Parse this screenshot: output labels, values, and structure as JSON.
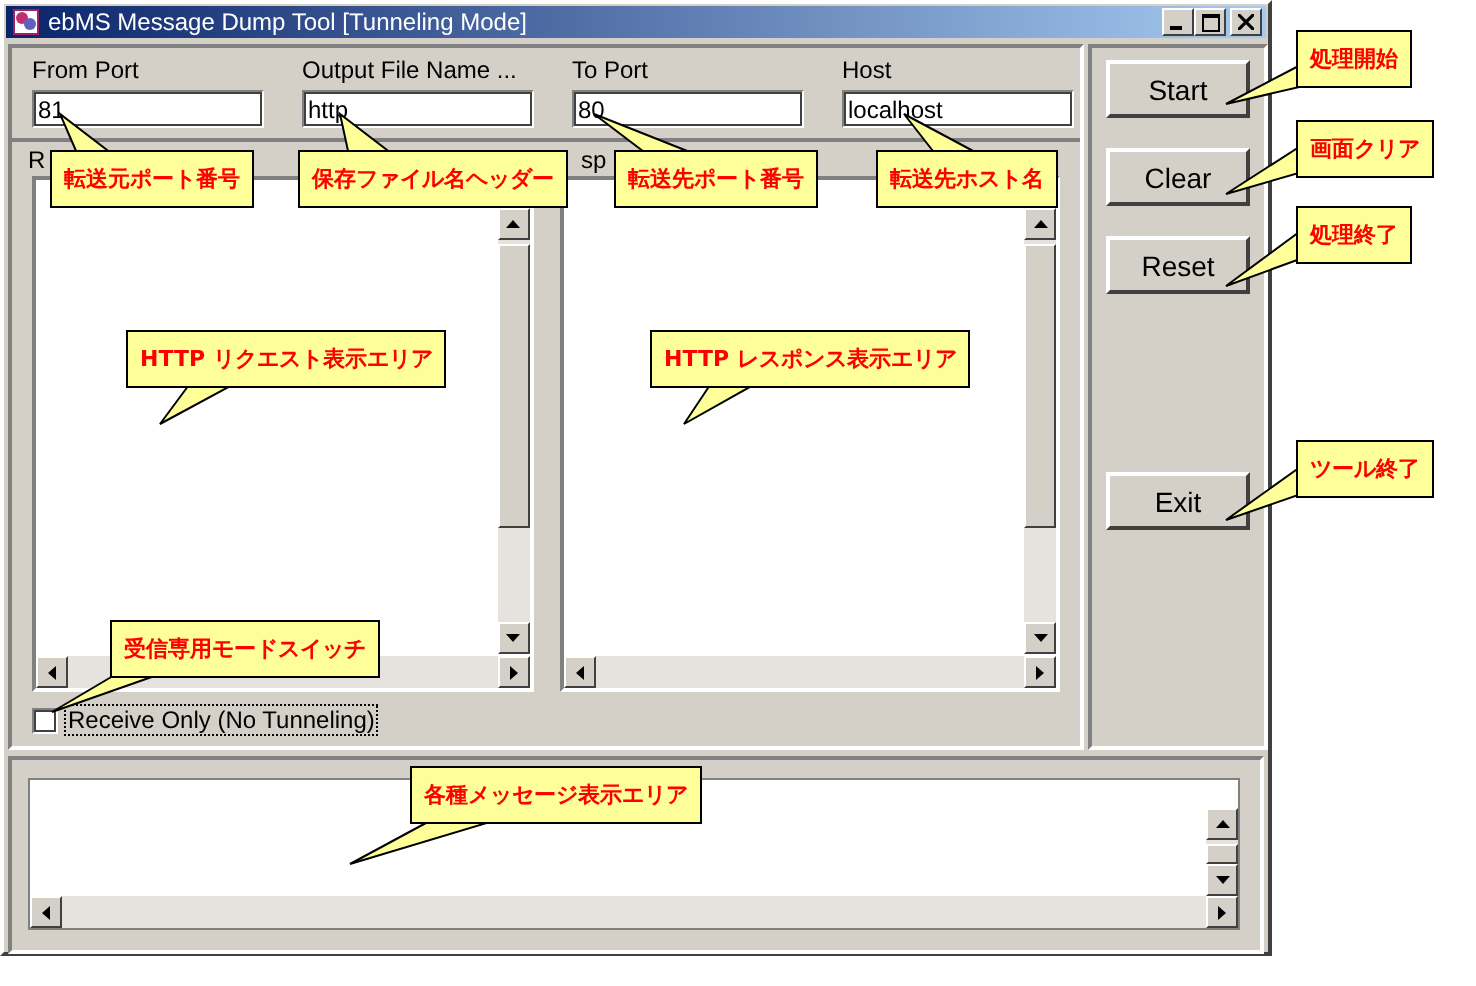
{
  "window": {
    "title": "ebMS Message Dump Tool [Tunneling Mode]"
  },
  "fields": [
    {
      "label": "From Port",
      "value": "81"
    },
    {
      "label": "Output File Name ...",
      "value": "http"
    },
    {
      "label": "To Port",
      "value": "80"
    },
    {
      "label": "Host",
      "value": "localhost"
    }
  ],
  "panes": [
    {
      "label": "R"
    },
    {
      "label": "sp"
    }
  ],
  "checkbox": {
    "label": "Receive Only (No Tunneling)",
    "checked": false,
    "focused": true
  },
  "buttons": [
    "Start",
    "Clear",
    "Reset",
    "Exit"
  ],
  "callouts": [
    {
      "text": "転送元ポート番号"
    },
    {
      "text": "保存ファイル名ヘッダー"
    },
    {
      "text": "転送先ポート番号"
    },
    {
      "text": "転送先ホスト名"
    },
    {
      "text": "処理開始"
    },
    {
      "text": "画面クリア"
    },
    {
      "text": "処理終了"
    },
    {
      "text": "ツール終了"
    },
    {
      "text": "HTTP リクエスト表示エリア"
    },
    {
      "text": "HTTP レスポンス表示エリア"
    },
    {
      "text": "受信専用モードスイッチ"
    },
    {
      "text": "各種メッセージ表示エリア"
    }
  ]
}
